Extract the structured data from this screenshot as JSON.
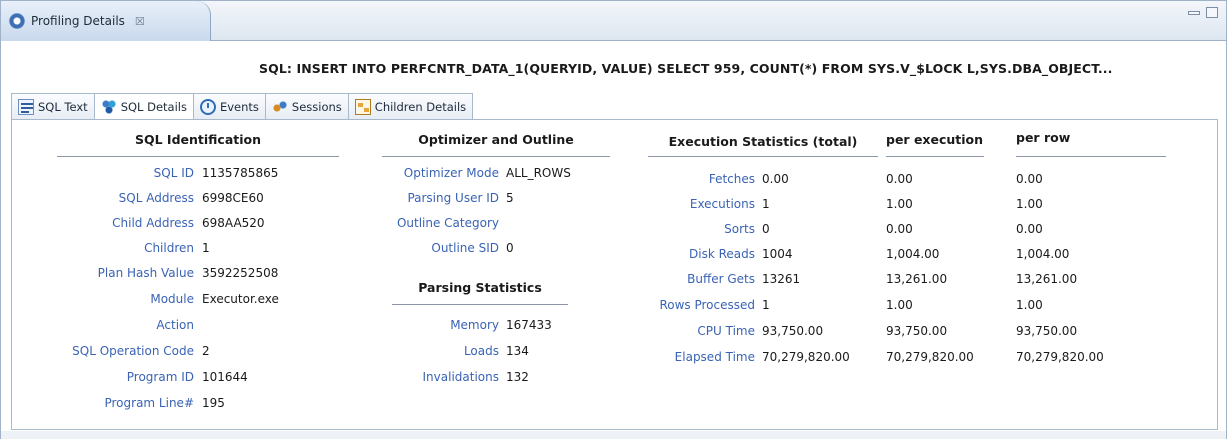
{
  "view": {
    "title": "Profiling Details",
    "close_glyph": "☒",
    "icons": {
      "view": "profiling-gear-icon",
      "minimize": "minimize-icon",
      "maximize": "maximize-icon"
    }
  },
  "sql_header": "SQL: INSERT INTO PERFCNTR_DATA_1(QUERYID, VALUE) SELECT 959, COUNT(*) FROM SYS.V_$LOCK L,SYS.DBA_OBJECT...",
  "tabs": [
    {
      "label": "SQL Text",
      "icon": "sql-text-icon",
      "active": false
    },
    {
      "label": "SQL Details",
      "icon": "sql-details-icon",
      "active": true
    },
    {
      "label": "Events",
      "icon": "events-icon",
      "active": false
    },
    {
      "label": "Sessions",
      "icon": "sessions-icon",
      "active": false
    },
    {
      "label": "Children Details",
      "icon": "children-details-icon",
      "active": false
    }
  ],
  "identification": {
    "title": "SQL Identification",
    "rows": [
      {
        "label": "SQL ID",
        "value": "1135785865"
      },
      {
        "label": "SQL Address",
        "value": "6998CE60"
      },
      {
        "label": "Child Address",
        "value": "698AA520"
      },
      {
        "label": "Children",
        "value": "1"
      },
      {
        "label": "Plan Hash Value",
        "value": "3592252508"
      },
      {
        "label": "Module",
        "value": "Executor.exe"
      },
      {
        "label": "Action",
        "value": ""
      },
      {
        "label": "SQL Operation Code",
        "value": "2"
      },
      {
        "label": "Program ID",
        "value": "101644"
      },
      {
        "label": "Program Line#",
        "value": "195"
      }
    ]
  },
  "optimizer": {
    "title": "Optimizer and Outline",
    "rows": [
      {
        "label": "Optimizer Mode",
        "value": "ALL_ROWS"
      },
      {
        "label": "Parsing User ID",
        "value": "5"
      },
      {
        "label": "Outline Category",
        "value": ""
      },
      {
        "label": "Outline SID",
        "value": "0"
      }
    ]
  },
  "parsing": {
    "title": "Parsing Statistics",
    "rows": [
      {
        "label": "Memory",
        "value": "167433"
      },
      {
        "label": "Loads",
        "value": "134"
      },
      {
        "label": "Invalidations",
        "value": "132"
      }
    ]
  },
  "execution": {
    "title": "Execution Statistics (total)",
    "col_per_execution": "per execution",
    "col_per_row": "per row",
    "rows": [
      {
        "label": "Fetches",
        "total": "0.00",
        "per_execution": "0.00",
        "per_row": "0.00"
      },
      {
        "label": "Executions",
        "total": "1",
        "per_execution": "1.00",
        "per_row": "1.00"
      },
      {
        "label": "Sorts",
        "total": "0",
        "per_execution": "0.00",
        "per_row": "0.00"
      },
      {
        "label": "Disk Reads",
        "total": "1004",
        "per_execution": "1,004.00",
        "per_row": "1,004.00"
      },
      {
        "label": "Buffer Gets",
        "total": "13261",
        "per_execution": "13,261.00",
        "per_row": "13,261.00"
      },
      {
        "label": "Rows Processed",
        "total": "1",
        "per_execution": "1.00",
        "per_row": "1.00"
      },
      {
        "label": "CPU Time",
        "total": "93,750.00",
        "per_execution": "93,750.00",
        "per_row": "93,750.00"
      },
      {
        "label": "Elapsed Time",
        "total": "70,279,820.00",
        "per_execution": "70,279,820.00",
        "per_row": "70,279,820.00"
      }
    ]
  }
}
